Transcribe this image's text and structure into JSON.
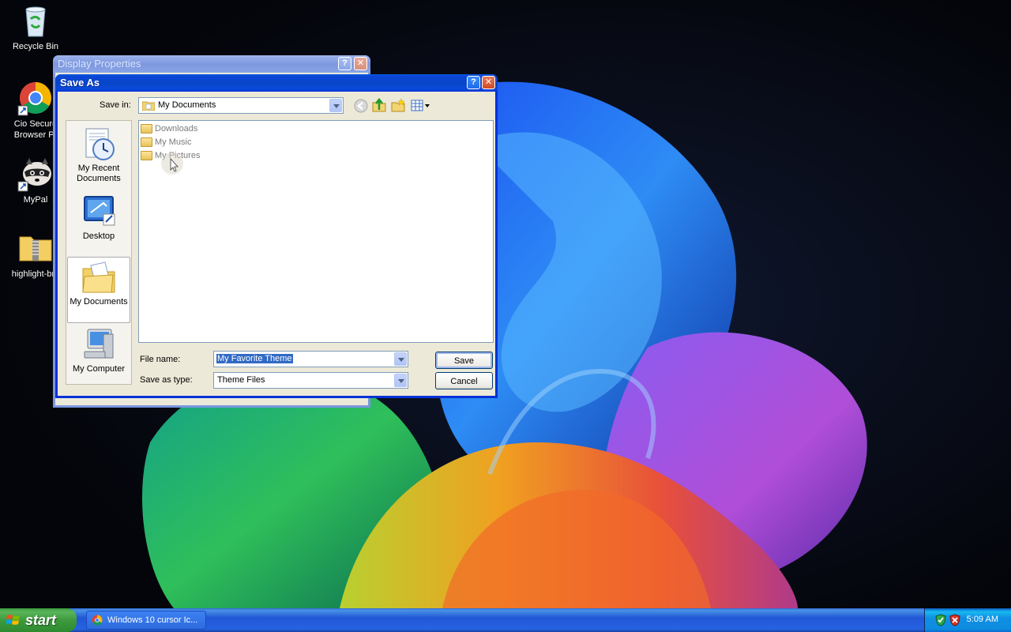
{
  "desktop": {
    "icons": [
      {
        "label": "Recycle Bin",
        "icon": "recycle-bin-icon"
      },
      {
        "label": "Cio Secure Browser Pr",
        "label_line1": "Cio Secure",
        "label_line2": "Browser Pr",
        "icon": "chrome-icon"
      },
      {
        "label": "MyPal",
        "icon": "raccoon-icon"
      },
      {
        "label": "highlight-bro",
        "icon": "zip-folder-icon"
      }
    ]
  },
  "display_properties": {
    "title": "Display Properties"
  },
  "save_as": {
    "title": "Save As",
    "save_in_label": "Save in:",
    "save_in_value": "My Documents",
    "places": [
      {
        "label_line1": "My Recent",
        "label_line2": "Documents",
        "icon": "recent-documents-icon"
      },
      {
        "label_line1": "Desktop",
        "label_line2": "",
        "icon": "desktop-icon"
      },
      {
        "label_line1": "My Documents",
        "label_line2": "",
        "icon": "my-documents-icon",
        "selected": true
      },
      {
        "label_line1": "My Computer",
        "label_line2": "",
        "icon": "my-computer-icon"
      }
    ],
    "files": [
      "Downloads",
      "My Music",
      "My Pictures"
    ],
    "file_name_label": "File name:",
    "file_name_value": "My Favorite Theme",
    "save_type_label": "Save as type:",
    "save_type_value": "Theme Files",
    "save_button": "Save",
    "cancel_button": "Cancel",
    "help_glyph": "?",
    "close_glyph": "✕"
  },
  "taskbar": {
    "start_label": "start",
    "task_item": "Windows 10 cursor Ic...",
    "clock": "5:09 AM"
  },
  "colors": {
    "xp_blue": "#0831d9",
    "dialog_bg": "#ece9d8",
    "taskbar_blue": "#245edb",
    "start_green": "#3d9a3d",
    "selection_blue": "#316ac5"
  }
}
